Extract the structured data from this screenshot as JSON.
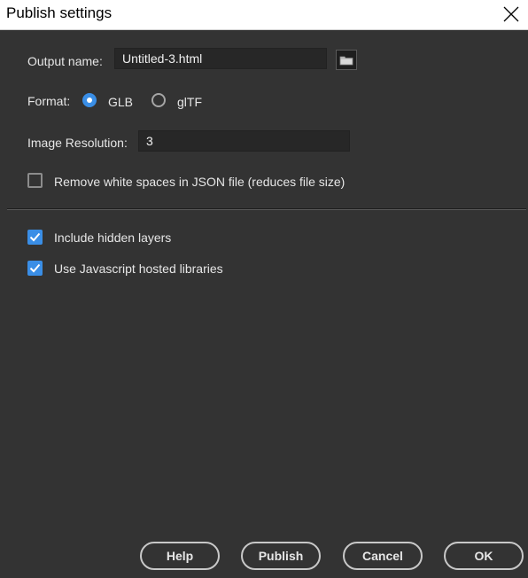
{
  "window": {
    "title": "Publish settings",
    "close_icon": "close-icon"
  },
  "output": {
    "label": "Output name:",
    "value": "Untitled-3.html",
    "browse_icon": "folder-icon"
  },
  "format": {
    "label": "Format:",
    "options": [
      {
        "label": "GLB",
        "selected": true
      },
      {
        "label": "glTF",
        "selected": false
      }
    ]
  },
  "resolution": {
    "label": "Image Resolution:",
    "value": "3"
  },
  "options": {
    "remove_whitespace": {
      "label": "Remove white spaces in JSON file (reduces file size)",
      "checked": false
    },
    "include_hidden": {
      "label": "Include hidden layers",
      "checked": true
    },
    "hosted_libraries": {
      "label": "Use Javascript hosted libraries",
      "checked": true
    }
  },
  "buttons": {
    "help": "Help",
    "publish": "Publish",
    "cancel": "Cancel",
    "ok": "OK"
  },
  "colors": {
    "panel_bg": "#333333",
    "accent": "#3a8ee6",
    "text": "#e6e6e6"
  }
}
